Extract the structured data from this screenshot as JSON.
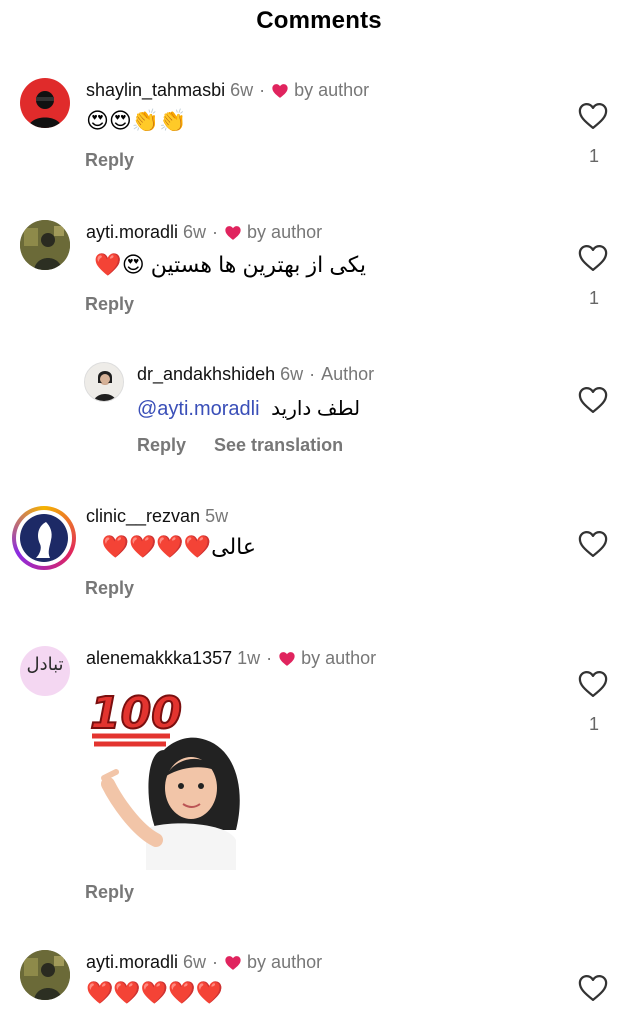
{
  "header": {
    "title": "Comments"
  },
  "comments": [
    {
      "username": "shaylin_tahmasbi",
      "time": "6w",
      "separator": "·",
      "author_badge": "by author",
      "text": "😍😍👏👏",
      "reply_label": "Reply",
      "like_count": "1"
    },
    {
      "username": "ayti.moradli",
      "time": "6w",
      "separator": "·",
      "author_badge": "by author",
      "text": "یکی از بهترین ها هستین 😍❤️",
      "reply_label": "Reply",
      "like_count": "1"
    },
    {
      "username": "dr_andakhshideh",
      "time": "6w",
      "separator": "·",
      "author_tag": "Author",
      "mention": "@ayti.moradli",
      "text": "لطف دارید",
      "reply_label": "Reply",
      "see_translation_label": "See translation"
    },
    {
      "username": "clinic__rezvan",
      "time": "5w",
      "text": "عالی❤️❤️❤️❤️",
      "reply_label": "Reply"
    },
    {
      "username": "alenemakkka1357",
      "time": "1w",
      "separator": "·",
      "author_badge": "by author",
      "sticker_text": "100",
      "reply_label": "Reply",
      "like_count": "1",
      "avatar_text": "تبادل"
    },
    {
      "username": "ayti.moradli",
      "time": "6w",
      "separator": "·",
      "author_badge": "by author",
      "text": "❤️❤️❤️❤️❤️"
    }
  ],
  "colors": {
    "heart_red": "#e0245e",
    "meta_grey": "#777777",
    "mention_blue": "#3a4fb8"
  }
}
